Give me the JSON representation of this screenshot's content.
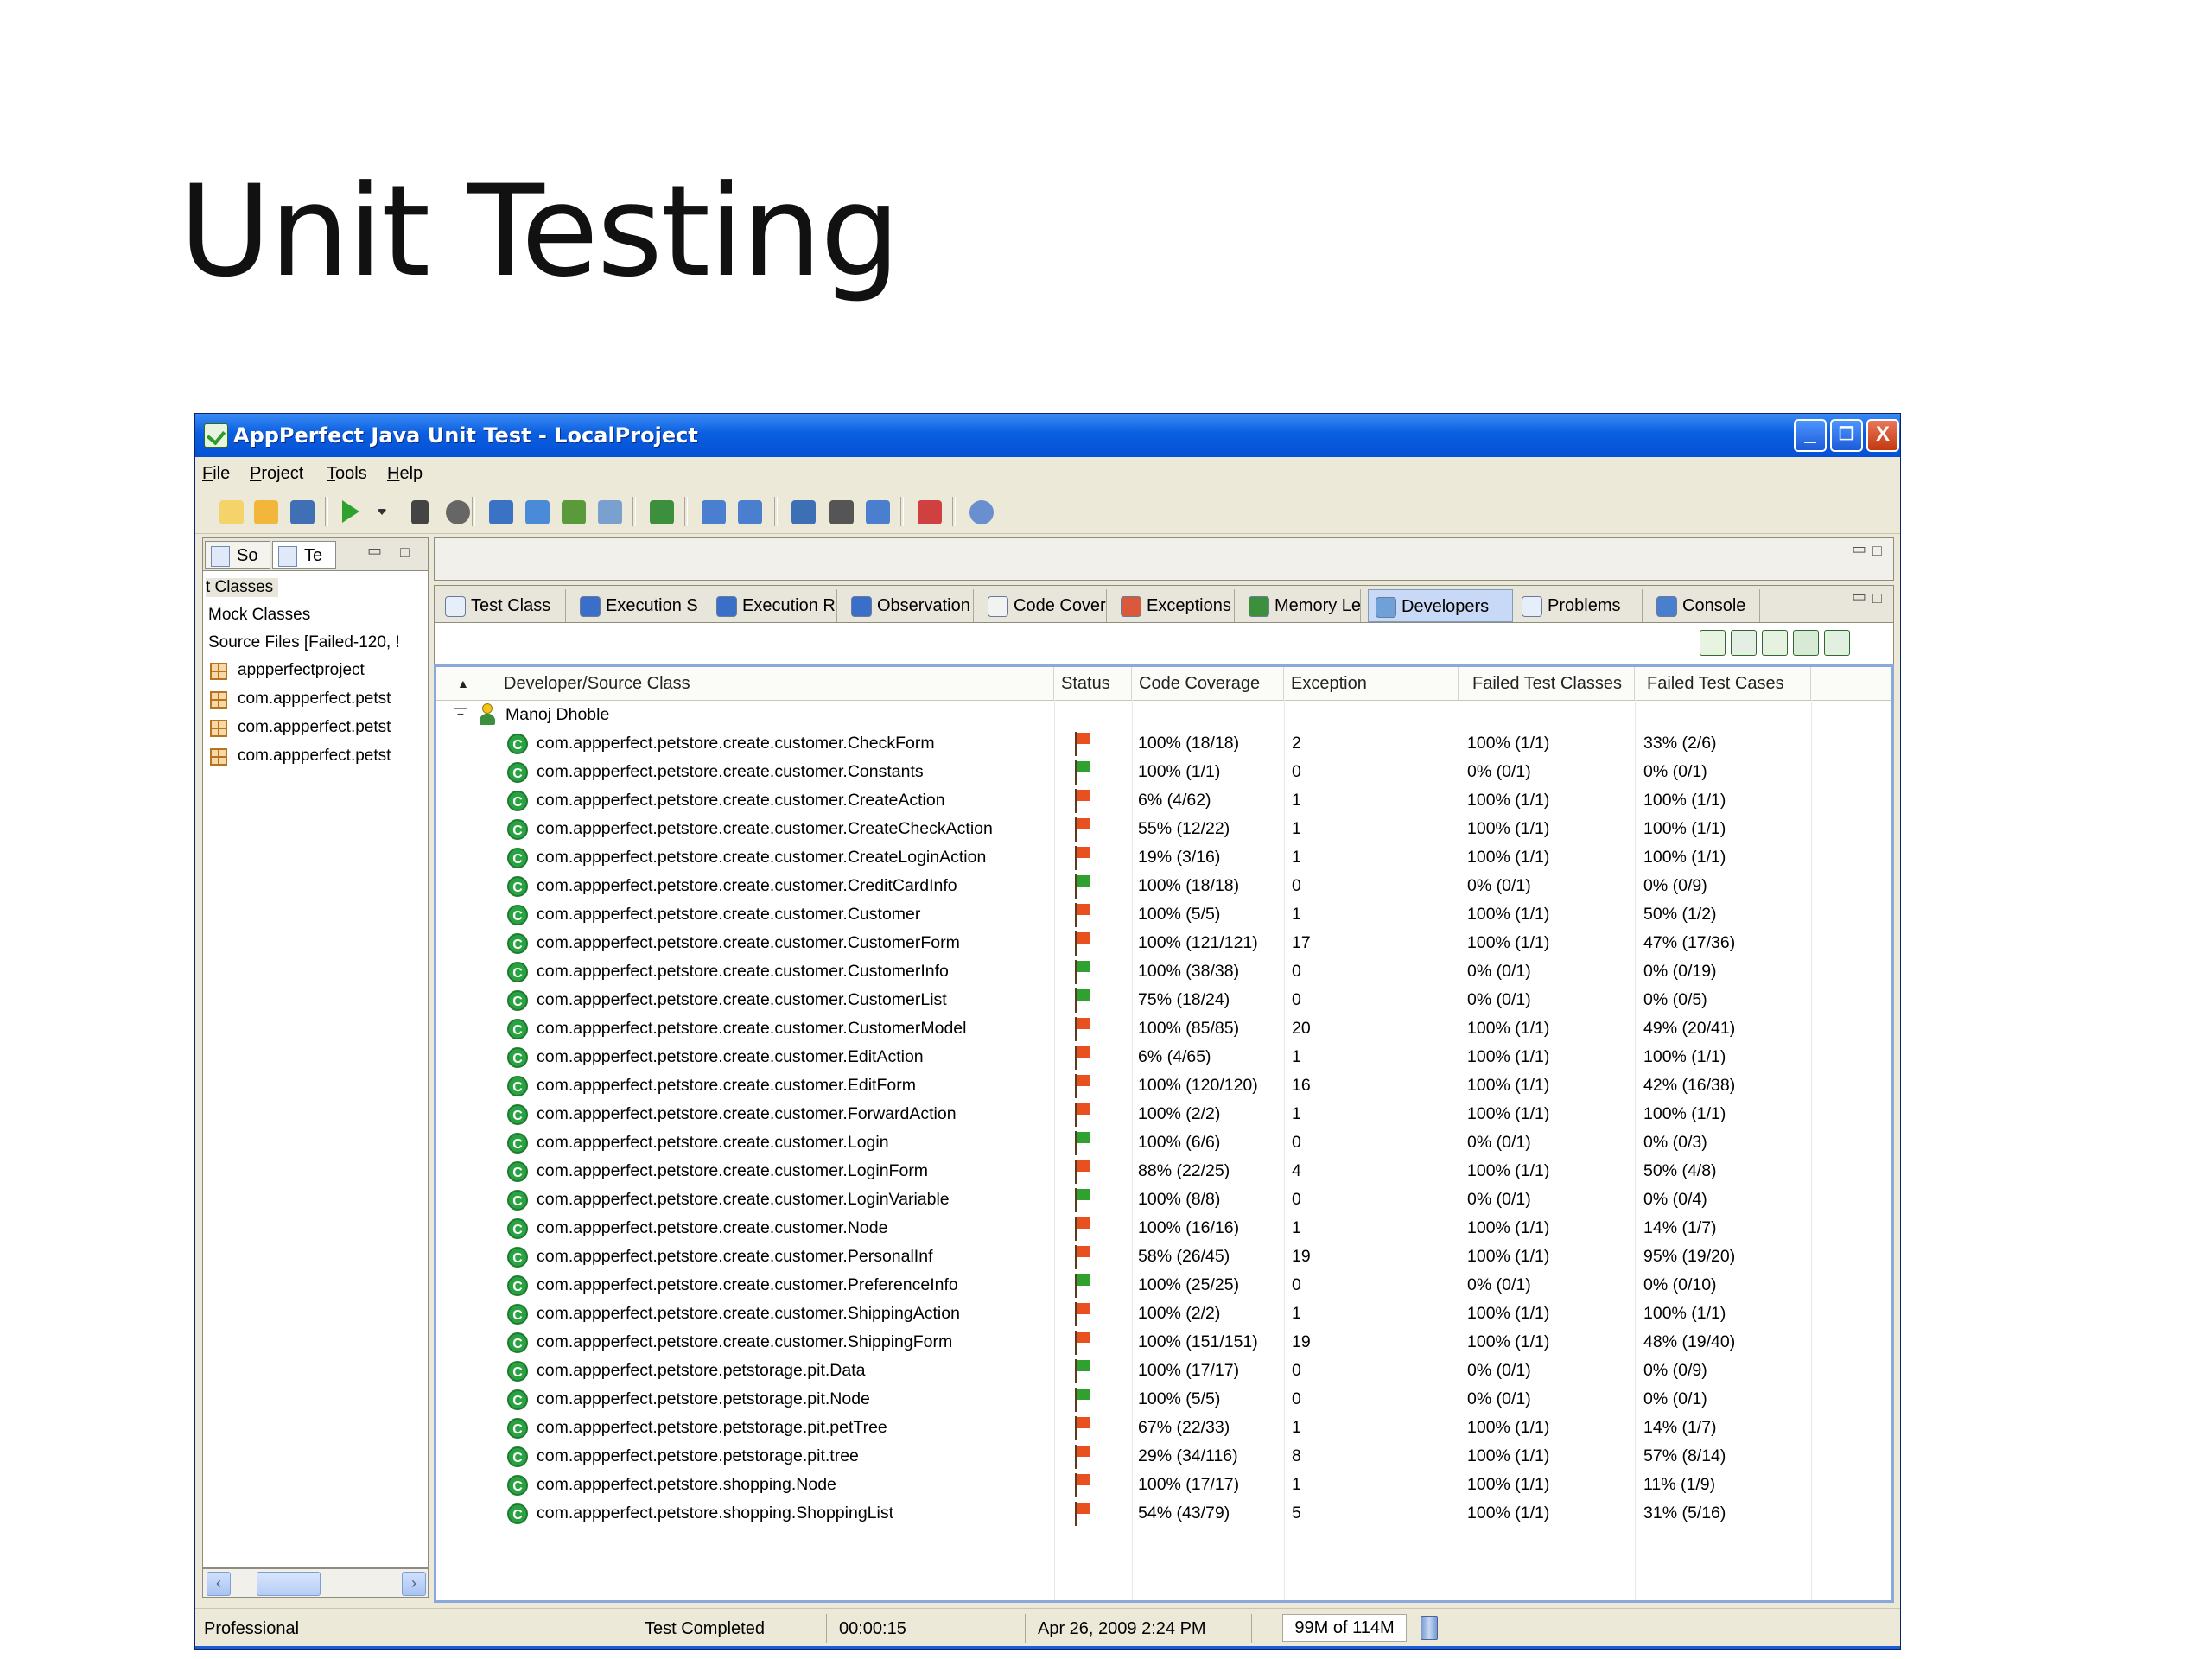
{
  "slide": {
    "title": "Unit Testing"
  },
  "window": {
    "title": "AppPerfect Java Unit Test - LocalProject",
    "minimize": "_",
    "restore": "❐",
    "close": "X"
  },
  "menu": [
    "File",
    "Project",
    "Tools",
    "Help"
  ],
  "toolbar_icons": [
    "new-icon",
    "open-icon",
    "save-icon",
    "run-icon",
    "dropdown-icon",
    "stop-icon",
    "record-icon",
    "refresh-icon",
    "generate-icon",
    "build-icon",
    "compare-icon",
    "users-icon",
    "edit-icon",
    "window-icon",
    "monitor-icon",
    "bug-icon",
    "report-icon",
    "checklist-icon",
    "help-icon"
  ],
  "left": {
    "tabs": [
      "So",
      "Te"
    ],
    "items": [
      "t Classes",
      "Mock Classes",
      "Source Files [Failed-120, !"
    ],
    "packages": [
      "appperfectproject",
      "com.appperfect.petst",
      "com.appperfect.petst",
      "com.appperfect.petst"
    ]
  },
  "tabs": [
    "Test Class",
    "Execution S",
    "Execution R",
    "Observation",
    "Code Cover",
    "Exceptions",
    "Memory Lea",
    "Developers",
    "Problems",
    "Console"
  ],
  "active_tab": "Developers",
  "table": {
    "sort_indicator": "▲",
    "headers": [
      "Developer/Source Class",
      "Status",
      "Code Coverage",
      "Exception",
      "Failed Test Classes",
      "Failed Test Cases"
    ],
    "developer": "Manoj Dhoble",
    "rows": [
      {
        "cls": "com.appperfect.petstore.create.customer.CheckForm",
        "status": "fail",
        "cov": "100% (18/18)",
        "exc": "2",
        "ftc": "100% (1/1)",
        "ftcs": "33% (2/6)"
      },
      {
        "cls": "com.appperfect.petstore.create.customer.Constants",
        "status": "pass",
        "cov": "100% (1/1)",
        "exc": "0",
        "ftc": "0% (0/1)",
        "ftcs": "0% (0/1)"
      },
      {
        "cls": "com.appperfect.petstore.create.customer.CreateAction",
        "status": "fail",
        "cov": "6% (4/62)",
        "exc": "1",
        "ftc": "100% (1/1)",
        "ftcs": "100% (1/1)"
      },
      {
        "cls": "com.appperfect.petstore.create.customer.CreateCheckAction",
        "status": "fail",
        "cov": "55% (12/22)",
        "exc": "1",
        "ftc": "100% (1/1)",
        "ftcs": "100% (1/1)"
      },
      {
        "cls": "com.appperfect.petstore.create.customer.CreateLoginAction",
        "status": "fail",
        "cov": "19% (3/16)",
        "exc": "1",
        "ftc": "100% (1/1)",
        "ftcs": "100% (1/1)"
      },
      {
        "cls": "com.appperfect.petstore.create.customer.CreditCardInfo",
        "status": "pass",
        "cov": "100% (18/18)",
        "exc": "0",
        "ftc": "0% (0/1)",
        "ftcs": "0% (0/9)"
      },
      {
        "cls": "com.appperfect.petstore.create.customer.Customer",
        "status": "fail",
        "cov": "100% (5/5)",
        "exc": "1",
        "ftc": "100% (1/1)",
        "ftcs": "50% (1/2)"
      },
      {
        "cls": "com.appperfect.petstore.create.customer.CustomerForm",
        "status": "fail",
        "cov": "100% (121/121)",
        "exc": "17",
        "ftc": "100% (1/1)",
        "ftcs": "47% (17/36)"
      },
      {
        "cls": "com.appperfect.petstore.create.customer.CustomerInfo",
        "status": "pass",
        "cov": "100% (38/38)",
        "exc": "0",
        "ftc": "0% (0/1)",
        "ftcs": "0% (0/19)"
      },
      {
        "cls": "com.appperfect.petstore.create.customer.CustomerList",
        "status": "pass",
        "cov": "75% (18/24)",
        "exc": "0",
        "ftc": "0% (0/1)",
        "ftcs": "0% (0/5)"
      },
      {
        "cls": "com.appperfect.petstore.create.customer.CustomerModel",
        "status": "fail",
        "cov": "100% (85/85)",
        "exc": "20",
        "ftc": "100% (1/1)",
        "ftcs": "49% (20/41)"
      },
      {
        "cls": "com.appperfect.petstore.create.customer.EditAction",
        "status": "fail",
        "cov": "6% (4/65)",
        "exc": "1",
        "ftc": "100% (1/1)",
        "ftcs": "100% (1/1)"
      },
      {
        "cls": "com.appperfect.petstore.create.customer.EditForm",
        "status": "fail",
        "cov": "100% (120/120)",
        "exc": "16",
        "ftc": "100% (1/1)",
        "ftcs": "42% (16/38)"
      },
      {
        "cls": "com.appperfect.petstore.create.customer.ForwardAction",
        "status": "fail",
        "cov": "100% (2/2)",
        "exc": "1",
        "ftc": "100% (1/1)",
        "ftcs": "100% (1/1)"
      },
      {
        "cls": "com.appperfect.petstore.create.customer.Login",
        "status": "pass",
        "cov": "100% (6/6)",
        "exc": "0",
        "ftc": "0% (0/1)",
        "ftcs": "0% (0/3)"
      },
      {
        "cls": "com.appperfect.petstore.create.customer.LoginForm",
        "status": "fail",
        "cov": "88% (22/25)",
        "exc": "4",
        "ftc": "100% (1/1)",
        "ftcs": "50% (4/8)"
      },
      {
        "cls": "com.appperfect.petstore.create.customer.LoginVariable",
        "status": "pass",
        "cov": "100% (8/8)",
        "exc": "0",
        "ftc": "0% (0/1)",
        "ftcs": "0% (0/4)"
      },
      {
        "cls": "com.appperfect.petstore.create.customer.Node",
        "status": "fail",
        "cov": "100% (16/16)",
        "exc": "1",
        "ftc": "100% (1/1)",
        "ftcs": "14% (1/7)"
      },
      {
        "cls": "com.appperfect.petstore.create.customer.PersonalInf",
        "status": "fail",
        "cov": "58% (26/45)",
        "exc": "19",
        "ftc": "100% (1/1)",
        "ftcs": "95% (19/20)"
      },
      {
        "cls": "com.appperfect.petstore.create.customer.PreferenceInfo",
        "status": "pass",
        "cov": "100% (25/25)",
        "exc": "0",
        "ftc": "0% (0/1)",
        "ftcs": "0% (0/10)"
      },
      {
        "cls": "com.appperfect.petstore.create.customer.ShippingAction",
        "status": "fail",
        "cov": "100% (2/2)",
        "exc": "1",
        "ftc": "100% (1/1)",
        "ftcs": "100% (1/1)"
      },
      {
        "cls": "com.appperfect.petstore.create.customer.ShippingForm",
        "status": "fail",
        "cov": "100% (151/151)",
        "exc": "19",
        "ftc": "100% (1/1)",
        "ftcs": "48% (19/40)"
      },
      {
        "cls": "com.appperfect.petstore.petstorage.pit.Data",
        "status": "pass",
        "cov": "100% (17/17)",
        "exc": "0",
        "ftc": "0% (0/1)",
        "ftcs": "0% (0/9)"
      },
      {
        "cls": "com.appperfect.petstore.petstorage.pit.Node",
        "status": "pass",
        "cov": "100% (5/5)",
        "exc": "0",
        "ftc": "0% (0/1)",
        "ftcs": "0% (0/1)"
      },
      {
        "cls": "com.appperfect.petstore.petstorage.pit.petTree",
        "status": "fail",
        "cov": "67% (22/33)",
        "exc": "1",
        "ftc": "100% (1/1)",
        "ftcs": "14% (1/7)"
      },
      {
        "cls": "com.appperfect.petstore.petstorage.pit.tree",
        "status": "fail",
        "cov": "29% (34/116)",
        "exc": "8",
        "ftc": "100% (1/1)",
        "ftcs": "57% (8/14)"
      },
      {
        "cls": "com.appperfect.petstore.shopping.Node",
        "status": "fail",
        "cov": "100% (17/17)",
        "exc": "1",
        "ftc": "100% (1/1)",
        "ftcs": "11% (1/9)"
      },
      {
        "cls": "com.appperfect.petstore.shopping.ShoppingList",
        "status": "fail",
        "cov": "54% (43/79)",
        "exc": "5",
        "ftc": "100% (1/1)",
        "ftcs": "31% (5/16)"
      }
    ]
  },
  "status": {
    "edition": "Professional",
    "state": "Test Completed",
    "elapsed": "00:00:15",
    "datetime": "Apr 26, 2009 2:24 PM",
    "memory": "99M of 114M"
  },
  "colors": {
    "pass": "#2fa12f",
    "fail": "#e8501f",
    "titlebar": "#0a5ee0",
    "class_icon": "#29a341"
  }
}
